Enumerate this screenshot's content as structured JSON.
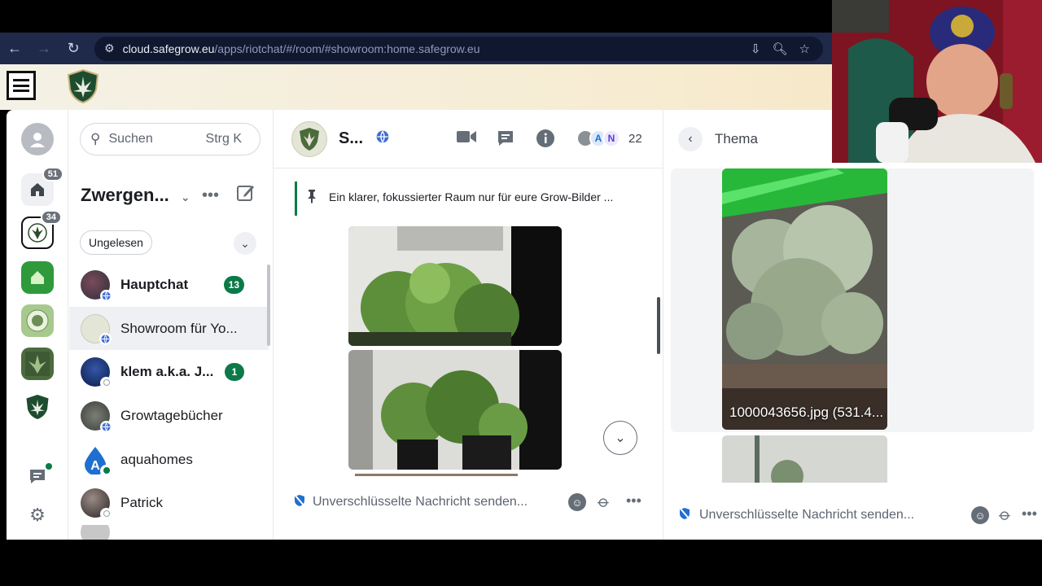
{
  "browser": {
    "url_domain": "cloud.safegrow.eu",
    "url_path": "/apps/riotchat/#/room/#showroom:home.safegrow.eu"
  },
  "spaces": [
    {
      "name": "home-space",
      "badge": "51"
    },
    {
      "name": "zwergen-space",
      "badge": "34"
    },
    {
      "name": "garten-space",
      "badge": ""
    },
    {
      "name": "seal-space",
      "badge": ""
    },
    {
      "name": "plant-space",
      "badge": ""
    },
    {
      "name": "safegrow-space",
      "badge": ""
    }
  ],
  "roomlist": {
    "search_placeholder": "Suchen",
    "search_shortcut": "Strg K",
    "space_title": "Zwergen...",
    "filter": "Ungelesen",
    "rooms": [
      {
        "name": "Hauptchat",
        "count": "13",
        "bold": true
      },
      {
        "name": "Showroom für Yo...",
        "count": "",
        "bold": false
      },
      {
        "name": "klem a.k.a. J...",
        "count": "1",
        "bold": true
      },
      {
        "name": "Growtagebücher",
        "count": "",
        "bold": false
      },
      {
        "name": "aquahomes",
        "count": "",
        "bold": false
      },
      {
        "name": "Patrick",
        "count": "",
        "bold": false
      }
    ]
  },
  "room": {
    "name": "S...",
    "member_count": "22",
    "member_initials": [
      "A",
      "N"
    ],
    "pinned_message": "Ein klarer, fokussierter Raum nur für eure Grow-Bilder ...",
    "composer_placeholder": "Unverschlüsselte Nachricht senden..."
  },
  "thread": {
    "title": "Thema",
    "file_caption": "1000043656.jpg (531.4...",
    "composer_placeholder": "Unverschlüsselte Nachricht senden..."
  },
  "colors": {
    "accent_green": "#0b7a48",
    "browser_bar": "#1f2a4a"
  }
}
